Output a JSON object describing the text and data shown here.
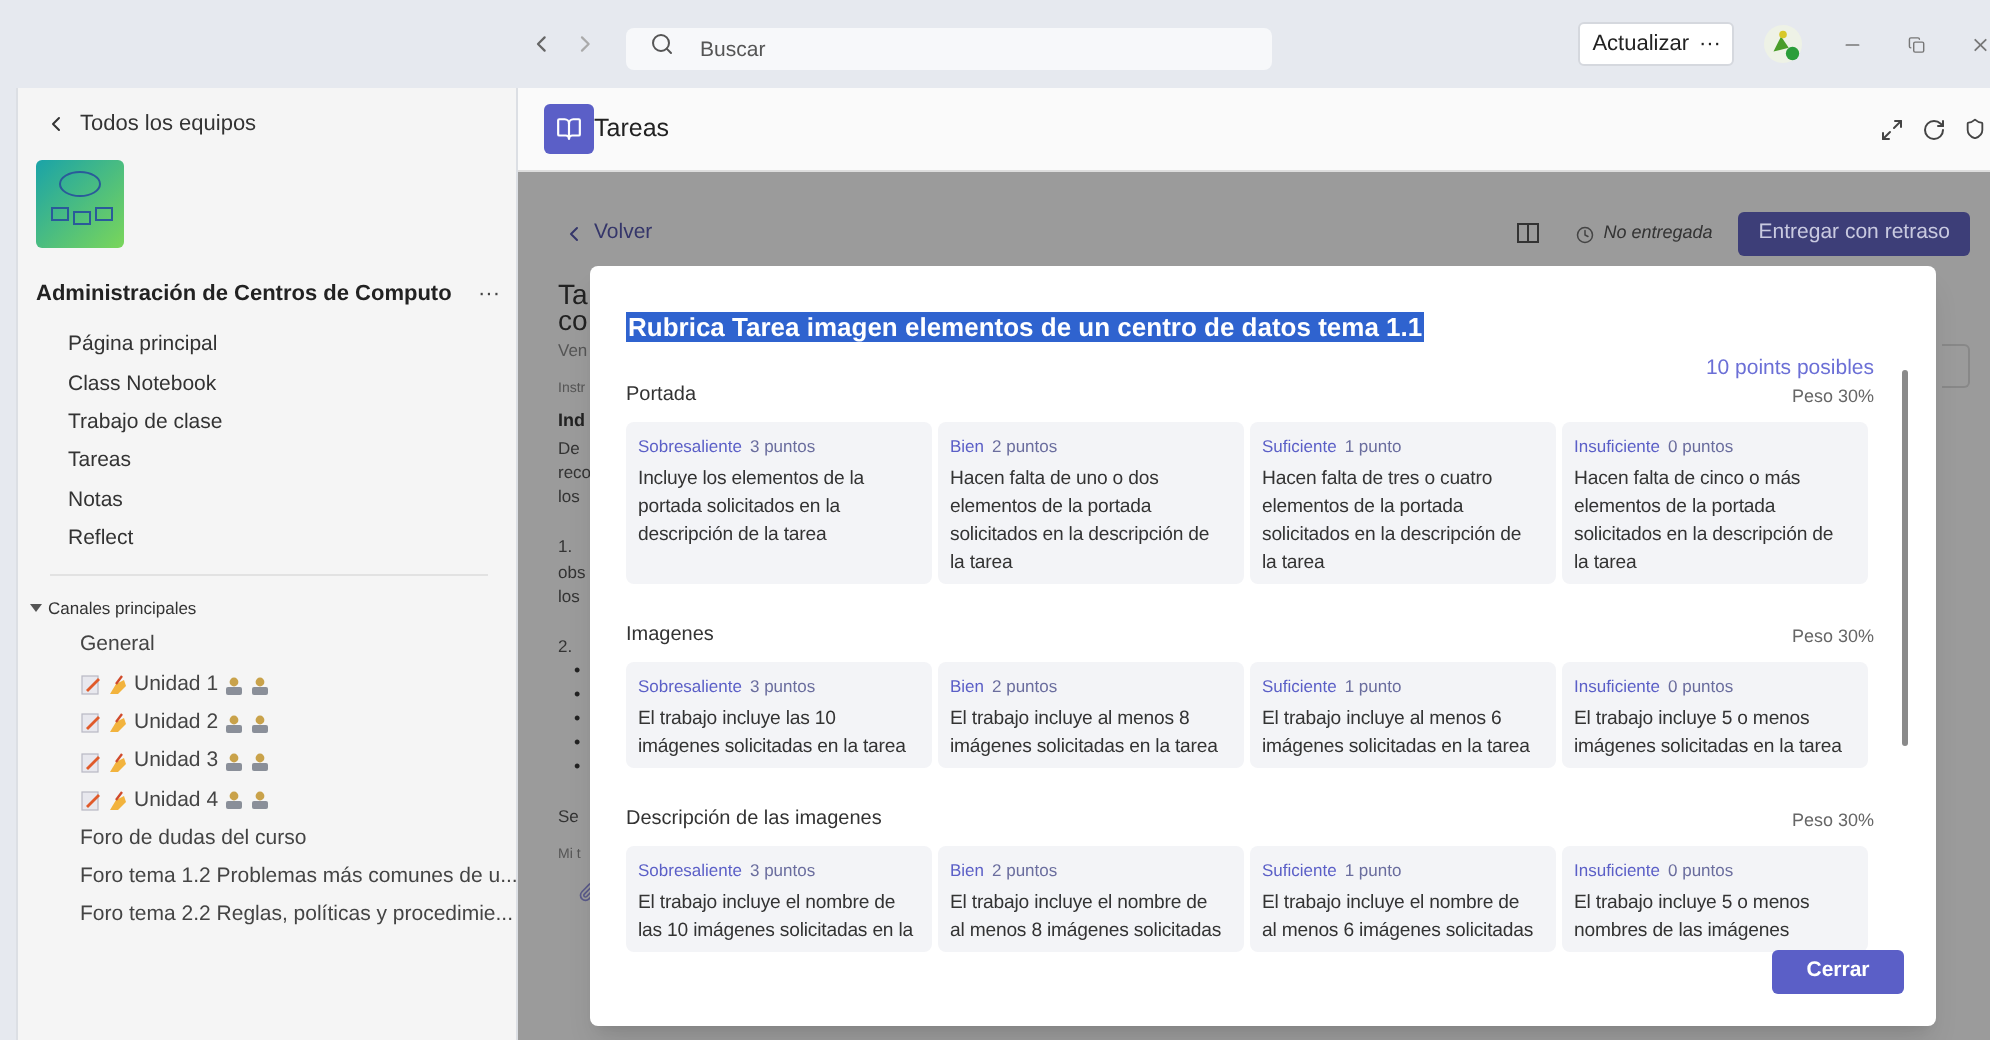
{
  "titlebar": {
    "search": {
      "placeholder": "Buscar"
    },
    "update_button": "Actualizar",
    "more": "···"
  },
  "sidebar": {
    "back": "Todos los equipos",
    "team_name": "Administración de Centros de Computo",
    "team_more": "···",
    "nav": [
      {
        "label": "Página principal",
        "selected": false
      },
      {
        "label": "Class Notebook",
        "selected": false
      },
      {
        "label": "Trabajo de clase",
        "selected": false
      },
      {
        "label": "Tareas",
        "selected": false
      },
      {
        "label": "Notas",
        "selected": false
      },
      {
        "label": "Reflect",
        "selected": false
      }
    ],
    "section": {
      "label": "Canales principales",
      "expanded": true
    },
    "channels": [
      {
        "label": "General",
        "kind": "plain"
      },
      {
        "label": "Unidad 1",
        "kind": "decorated"
      },
      {
        "label": "Unidad 2",
        "kind": "decorated"
      },
      {
        "label": "Unidad 3",
        "kind": "decorated"
      },
      {
        "label": "Unidad 4",
        "kind": "decorated"
      },
      {
        "label": "Foro de dudas del curso",
        "kind": "plain"
      },
      {
        "label": "Foro tema 1.2 Problemas más comunes de u...",
        "kind": "plain"
      },
      {
        "label": "Foro tema 2.2 Reglas, políticas y procedimie...",
        "kind": "plain"
      }
    ]
  },
  "app_header": {
    "title": "Tareas"
  },
  "assignment": {
    "back": "Volver",
    "status": "No entregada",
    "submit_button": "Entregar con retraso",
    "fragments": [
      {
        "text": "Ta",
        "kind": "title"
      },
      {
        "text": "co",
        "kind": "title"
      },
      {
        "text": "Ven",
        "kind": "meta"
      },
      {
        "text": "Instr",
        "kind": "label"
      },
      {
        "text": "Ind",
        "kind": "bold"
      },
      {
        "text": "De",
        "kind": "body"
      },
      {
        "text": "reco",
        "kind": "body"
      },
      {
        "text": "los",
        "kind": "body"
      },
      {
        "text": "1.",
        "kind": "gap"
      },
      {
        "text": "obs",
        "kind": "body"
      },
      {
        "text": "los",
        "kind": "body"
      },
      {
        "text": "2.",
        "kind": "gap"
      },
      {
        "text": "•",
        "kind": "bullet"
      },
      {
        "text": "•",
        "kind": "bullet"
      },
      {
        "text": "•",
        "kind": "bullet"
      },
      {
        "text": "•",
        "kind": "bullet"
      },
      {
        "text": "•",
        "kind": "bullet"
      },
      {
        "text": "Se",
        "kind": "gap"
      },
      {
        "text": "Mi t",
        "kind": "label"
      }
    ]
  },
  "dialog": {
    "title": "Rubrica Tarea imagen elementos de un centro de datos tema 1.1",
    "points": "10 points posibles",
    "criteria": [
      {
        "name": "Portada",
        "weight": "Peso 30%",
        "levels": [
          {
            "level": "Sobresaliente",
            "points": "3 puntos",
            "text": "Incluye los elementos de la portada solicitados en la descripción de la tarea"
          },
          {
            "level": "Bien",
            "points": "2 puntos",
            "text": "Hacen falta de uno o dos elementos de la portada solicitados en la descripción de la tarea"
          },
          {
            "level": "Suficiente",
            "points": "1 punto",
            "text": "Hacen falta de tres o cuatro elementos de la portada solicitados en la descripción de la tarea"
          },
          {
            "level": "Insuficiente",
            "points": "0 puntos",
            "text": "Hacen falta de cinco o más elementos de la portada solicitados en la descripción de la tarea"
          }
        ]
      },
      {
        "name": "Imagenes",
        "weight": "Peso 30%",
        "levels": [
          {
            "level": "Sobresaliente",
            "points": "3 puntos",
            "text": "El trabajo incluye las 10 imágenes solicitadas en la tarea"
          },
          {
            "level": "Bien",
            "points": "2 puntos",
            "text": "El trabajo incluye al menos 8 imágenes solicitadas en la tarea"
          },
          {
            "level": "Suficiente",
            "points": "1 punto",
            "text": "El trabajo incluye al menos 6 imágenes solicitadas en la tarea"
          },
          {
            "level": "Insuficiente",
            "points": "0 puntos",
            "text": "El trabajo incluye 5 o menos imágenes solicitadas en la tarea"
          }
        ]
      },
      {
        "name": "Descripción de las imagenes",
        "weight": "Peso 30%",
        "levels": [
          {
            "level": "Sobresaliente",
            "points": "3 puntos",
            "text": "El trabajo incluye el nombre de las 10 imágenes solicitadas en la"
          },
          {
            "level": "Bien",
            "points": "2 puntos",
            "text": "El trabajo incluye el nombre de al menos 8 imágenes solicitadas"
          },
          {
            "level": "Suficiente",
            "points": "1 punto",
            "text": "El trabajo incluye el nombre de al menos 6 imágenes solicitadas"
          },
          {
            "level": "Insuficiente",
            "points": "0 puntos",
            "text": "El trabajo incluye 5 o menos nombres de las imágenes"
          }
        ]
      }
    ],
    "close_button": "Cerrar"
  }
}
